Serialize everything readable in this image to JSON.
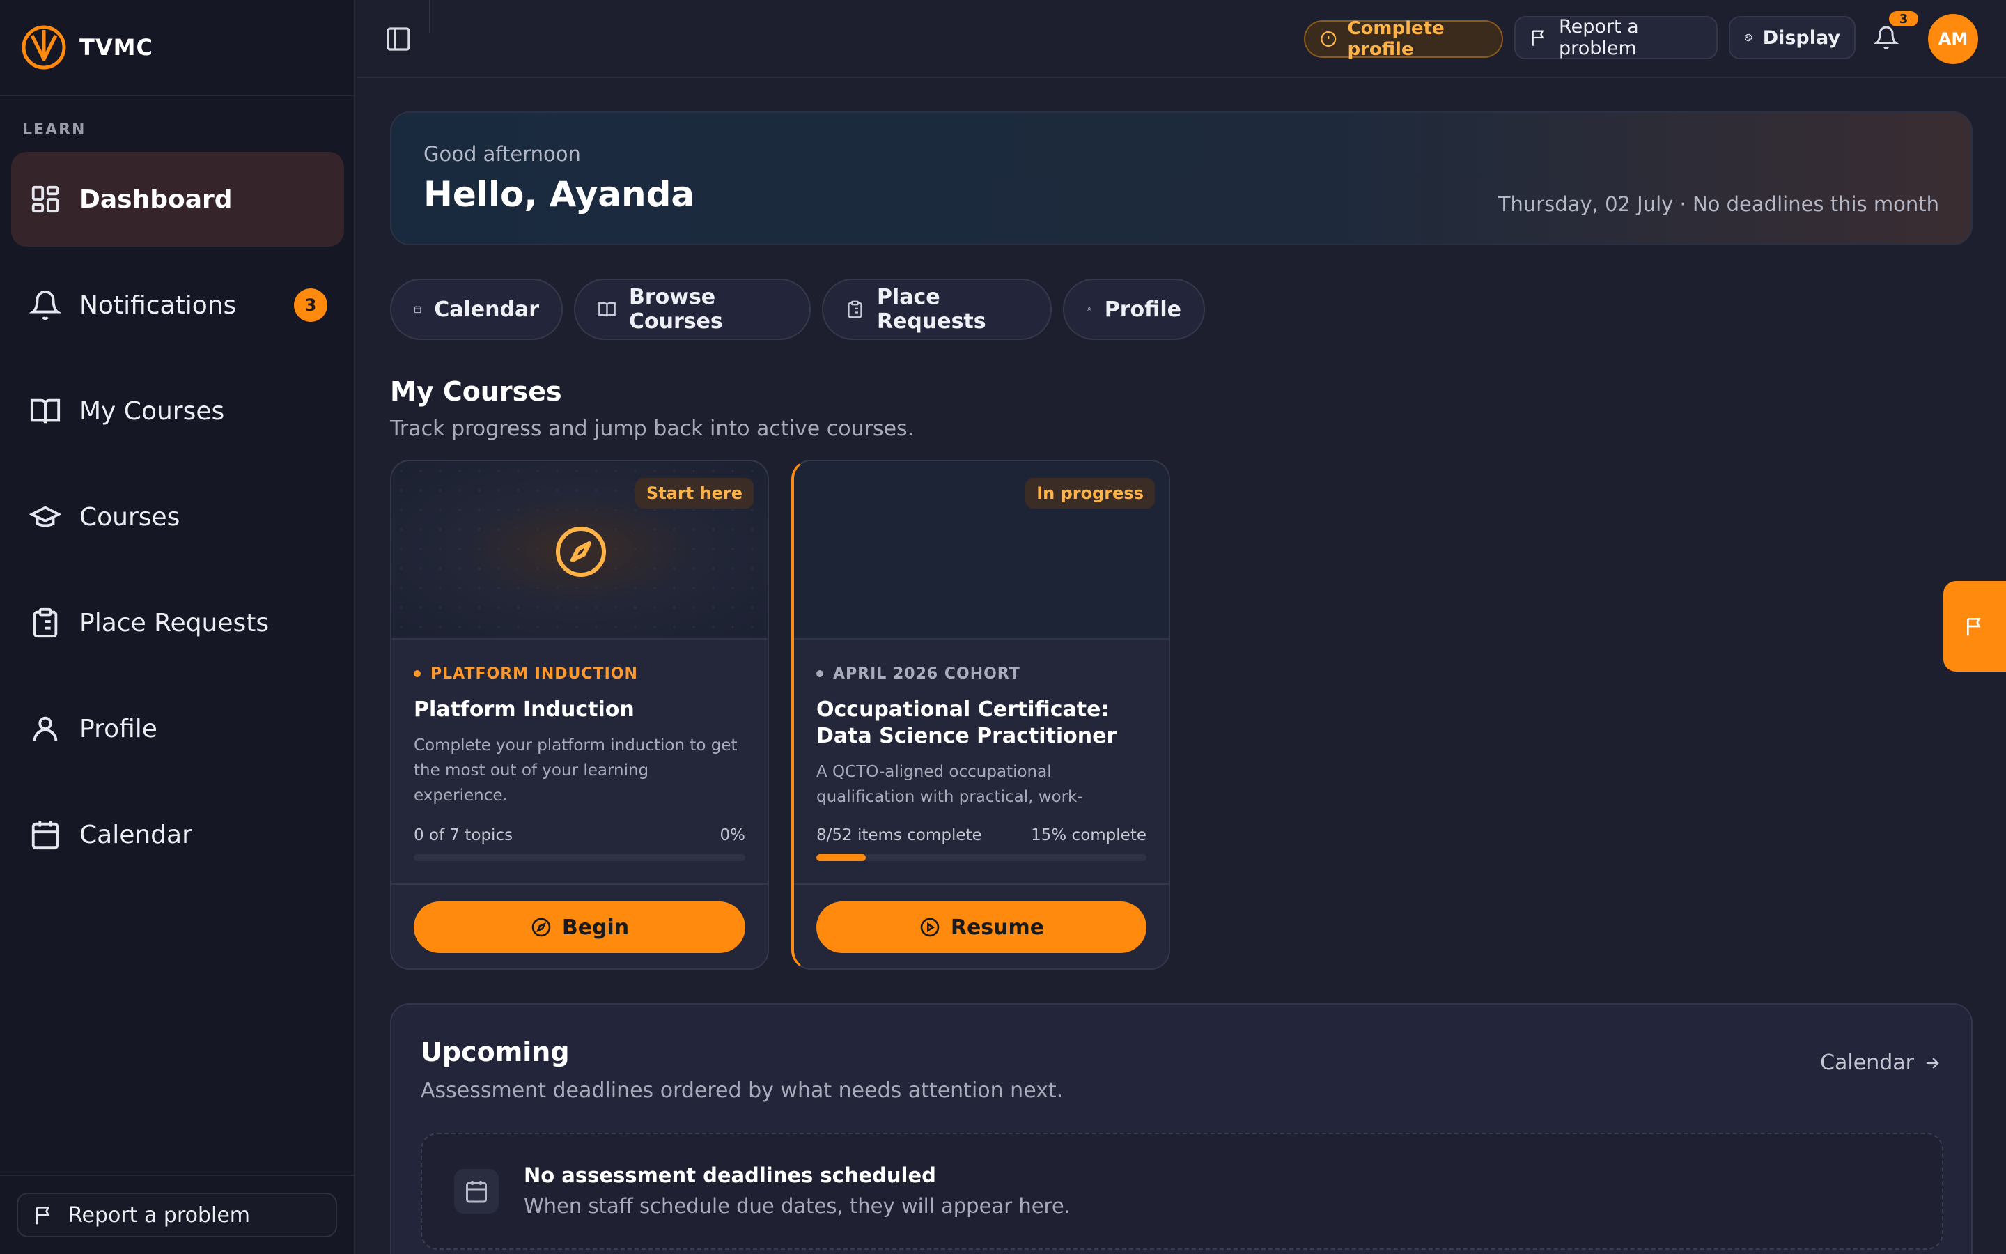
{
  "app": {
    "name": "TVMC",
    "accent": "#ff8a0d"
  },
  "sidebar": {
    "section_label": "LEARN",
    "items": [
      {
        "label": "Dashboard",
        "icon": "dashboard-icon",
        "active": true
      },
      {
        "label": "Notifications",
        "icon": "bell-icon",
        "badge": "3"
      },
      {
        "label": "My Courses",
        "icon": "book-open-icon"
      },
      {
        "label": "Courses",
        "icon": "graduation-cap-icon"
      },
      {
        "label": "Place Requests",
        "icon": "clipboard-icon"
      },
      {
        "label": "Profile",
        "icon": "user-icon"
      },
      {
        "label": "Calendar",
        "icon": "calendar-icon"
      }
    ],
    "footer_report": "Report a problem"
  },
  "topbar": {
    "complete_profile": "Complete profile",
    "report": "Report a problem",
    "display": "Display",
    "notification_count": "3",
    "avatar_initials": "AM"
  },
  "hero": {
    "greeting": "Good afternoon",
    "title": "Hello, Ayanda",
    "date_line": "Thursday, 02 July · No deadlines this month"
  },
  "quick_links": [
    "Calendar",
    "Browse Courses",
    "Place Requests",
    "Profile"
  ],
  "my_courses": {
    "title": "My Courses",
    "subtitle": "Track progress and jump back into active courses.",
    "cards": [
      {
        "badge": "Start here",
        "tag": "PLATFORM INDUCTION",
        "title": "Platform Induction",
        "description": "Complete your platform induction to get the most out of your learning experience.",
        "progress_text": "0 of 7 topics",
        "progress_pct_text": "0%",
        "progress": 0,
        "action": "Begin"
      },
      {
        "badge": "In progress",
        "tag": "APRIL 2026 COHORT",
        "title": "Occupational Certificate: Data Science Practitioner",
        "description": "A QCTO-aligned occupational qualification with practical, work-based…",
        "progress_text": "8/52 items complete",
        "progress_pct_text": "15% complete",
        "progress": 0.15,
        "action": "Resume"
      }
    ]
  },
  "upcoming": {
    "title": "Upcoming",
    "subtitle": "Assessment deadlines ordered by what needs attention next.",
    "link": "Calendar",
    "empty_title": "No assessment deadlines scheduled",
    "empty_subtitle": "When staff schedule due dates, they will appear here."
  }
}
